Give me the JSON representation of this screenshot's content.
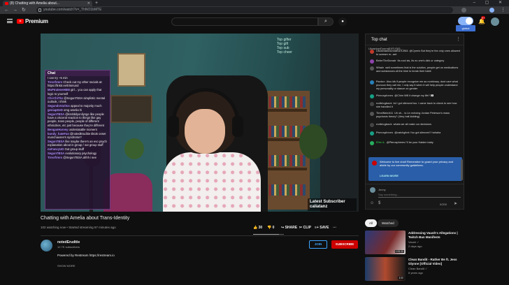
{
  "browser": {
    "tab_title": "(8) Chatting with Amelia about...",
    "url": "youtube.com/watch?v=_ThNO1bMTE",
    "icons": [
      "back-icon",
      "forward-icon",
      "reload-icon",
      "lock-icon",
      "star-icon",
      "extension-icon",
      "profile-icon",
      "kebab-icon"
    ]
  },
  "masthead": {
    "logo_text": "Premium",
    "notif_count": "9+"
  },
  "video": {
    "overlay_lines": [
      "Top gifter",
      "Top gift",
      "Top sub",
      "Top cheer"
    ],
    "latest_label": "Latest Subscriber",
    "latest_name": "caliatanz"
  },
  "stream_chat": {
    "title": "Chat",
    "messages": [
      {
        "user": "",
        "text": "I can try ~5 min"
      },
      {
        "user": "Trnsrfrmrs",
        "text": "Check out my other socials at: https://linktr.ee/trtsmund"
      },
      {
        "user": "MoPIrateneHEM",
        "text": "girl... you can apply that logic to yourself"
      },
      {
        "user": "Chi-ChiTkx",
        "text": "@SegunTBSA simplistic mental outlook, I think"
      },
      {
        "user": "SegundoVaritos",
        "text": "appeal to majority much"
      },
      {
        "user": "geniapDeD",
        "text": "omg amelia hi"
      },
      {
        "user": "SegunTBSA",
        "text": "@krobbilyonilynge like people have a visceral reaction to things like gay people, trans people, people of different ethnicities, etc just because they're different"
      },
      {
        "user": "BenganHarvey",
        "text": "undeniatable moment"
      },
      {
        "user": "bundy_hateFan",
        "text": "@notedEruditie tiktok onset munchausen's syndrome?"
      },
      {
        "user": "SegunTBSA",
        "text": "like maybe there's an evo psych explanation about in group / out group stuff"
      },
      {
        "user": "noFancyUD",
        "text": "Out group stuff"
      },
      {
        "user": "SegunTBSA",
        "text": "evolutionary psychology"
      },
      {
        "user": "Trnsrfrmrs",
        "text": "@SegunTBSA ahhh i see"
      }
    ]
  },
  "below": {
    "title": "Chatting with Amelia about Trans-Identity",
    "meta": "102 watching now • Started streaming 67 minutes ago",
    "likes": "30",
    "dislikes": "0",
    "share": "SHARE",
    "clip": "CLIP",
    "save": "SAVE",
    "like_ratio": 0.85,
    "channel": "notedEruditie",
    "subs": "12.7K subscribers",
    "join": "JOIN",
    "subscribe": "SUBSCRIBE",
    "description": "Powered by Restream https://restream.io",
    "show_more": "SHOW MORE"
  },
  "chat": {
    "title": "Top chat",
    "pinned": "UkrainianDunnaEATLE83 ...",
    "messages": [
      {
        "user": "UkrainianDunnaEATLE83",
        "text": "@Cymric But they're the only ones allowed to scream m...ant",
        "member": false,
        "color": "#c0392b"
      },
      {
        "user": "BeterTheDonair",
        "text": "Its cool sis, its no one's dick ur category",
        "member": false,
        "color": "#8e44ad"
      },
      {
        "user": "Whale",
        "text": "well sometimes that is the solution, people get on medications and substances all the time to break their habit",
        "member": false,
        "color": "#555"
      },
      {
        "user": "Paxton",
        "text": "Also idk if people recognize me as nonbinary, dont care what pronoun they call me, I only say it when it will help people understand my personality or stance on gender",
        "member": false,
        "color": "#2980b9"
      },
      {
        "user": "Pterospheres",
        "text": "@Chim Will it change my life? 👀",
        "member": false,
        "color": "#16a085"
      },
      {
        "user": "notblogback",
        "text": "lol I got silenced too. I came back to check to see how she handled it",
        "member": false,
        "color": "#444"
      },
      {
        "user": "TimeWatch11",
        "text": "Uh oh... is Liv echoing Jordan Peterson's mass psychosis theory? (Very half-kidding)",
        "member": false,
        "color": "#555"
      },
      {
        "user": "notblogback",
        "text": "whats we all make our decisions",
        "member": false,
        "color": "#444"
      },
      {
        "user": "Pterospheres",
        "text": "@catchgfork You got silenced? hahaha",
        "member": false,
        "color": "#16a085"
      },
      {
        "user": "Elite A.",
        "text": "@Pterospheres I'll be your Haiden baby",
        "member": true,
        "color": "#27ae60"
      }
    ],
    "notice_text": "Welcome to live chat! Remember to guard your privacy and abide by our community guidelines.",
    "notice_learn": "LEARN MORE",
    "input_name": "Jenny",
    "input_placeholder": "Say something...",
    "char_count": "0/200"
  },
  "recs": {
    "chips": [
      "All",
      "Watched"
    ],
    "items": [
      {
        "title": "Addressing Vaush's Allegations | Twitch Ban Manifests",
        "channel": "Vaush ✓",
        "meta": "2 days ago",
        "duration": "1:51:11"
      },
      {
        "title": "Clean Bandit - Rather Be ft. Jess Glynne [Official Video]",
        "channel": "Clean Bandit ✓",
        "meta": "8 years ago",
        "duration": "4:00"
      }
    ]
  },
  "extension": {
    "label": "global"
  }
}
